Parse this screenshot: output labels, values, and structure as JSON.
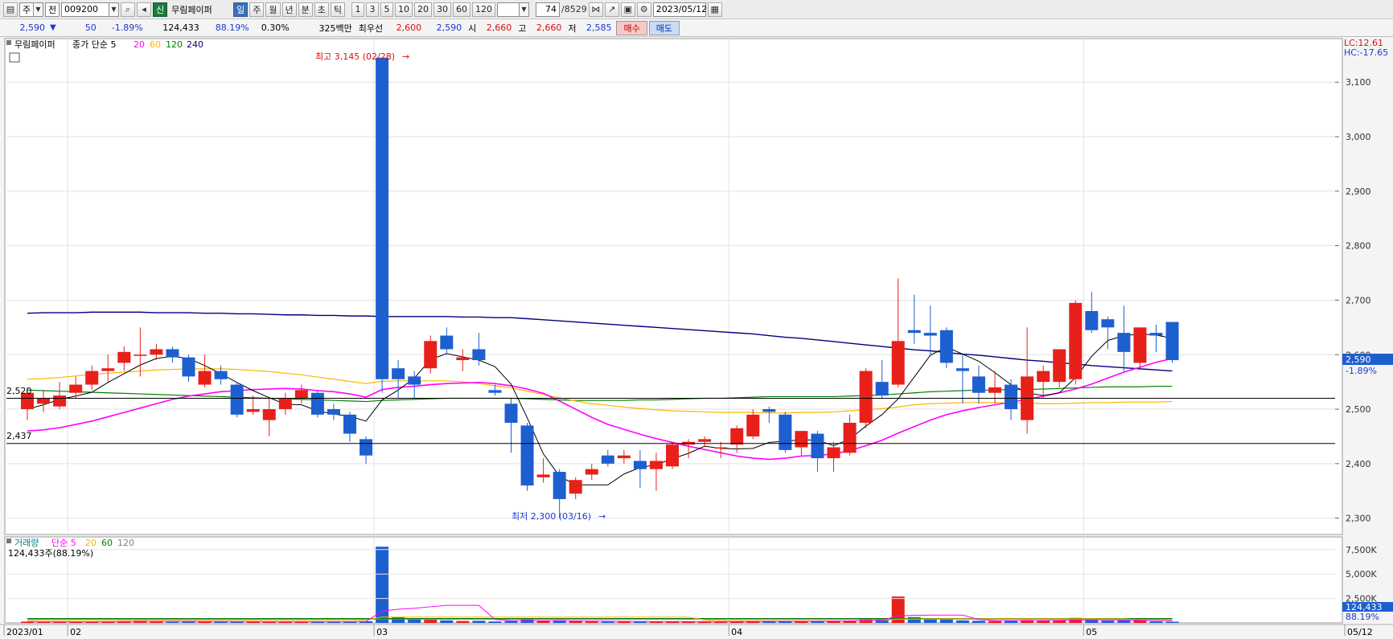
{
  "toolbar": {
    "market_type": "주",
    "market_sub": "전",
    "stock_code": "009200",
    "credit_badge": "신",
    "stock_name": "무림페이퍼",
    "periods": [
      "일",
      "주",
      "월",
      "년",
      "분",
      "초",
      "틱"
    ],
    "active_period": "일",
    "intervals": [
      "1",
      "3",
      "5",
      "10",
      "20",
      "30",
      "60",
      "120"
    ],
    "count_value": "74",
    "count_total": "/8529",
    "date": "2023/05/12"
  },
  "infobar": {
    "price": "2,590",
    "change_arrow": "▼",
    "change": "50",
    "change_pct": "-1.89%",
    "volume": "124,433",
    "volume_ratio": "88.19%",
    "turnover": "0.30%",
    "amount": "325백만",
    "best_label": "최우선",
    "best_ask": "2,600",
    "best_bid": "2,590",
    "open_label": "시",
    "open": "2,660",
    "high_label": "고",
    "high": "2,660",
    "low_label": "저",
    "low": "2,585",
    "buy_button": "매수",
    "sell_button": "매도"
  },
  "price_panel": {
    "stock_tag": "무림페이퍼",
    "ma_title": "종가 단순 5",
    "ma_periods": [
      {
        "label": "20",
        "color": "#ff00ff"
      },
      {
        "label": "60",
        "color": "#ffb400"
      },
      {
        "label": "120",
        "color": "#008000"
      },
      {
        "label": "240",
        "color": "#000080"
      }
    ],
    "lc_label": "LC:12.61",
    "hc_label": "HC:-17.65",
    "high_note": "최고 3,145 (02/28)",
    "low_note": "최저 2,300 (03/16)",
    "hline_1": "2,520",
    "hline_2": "2,437",
    "current_tag": "2,590",
    "current_pct": "-1.89%",
    "y_ticks": [
      "3,100",
      "3,000",
      "2,900",
      "2,800",
      "2,700",
      "2,600",
      "2,500",
      "2,400",
      "2,300"
    ]
  },
  "volume_panel": {
    "title": "거래량",
    "ma_title": "단순 5",
    "ma_periods": [
      {
        "label": "20",
        "color": "#ffb400"
      },
      {
        "label": "60",
        "color": "#008000"
      },
      {
        "label": "120",
        "color": "#808080"
      }
    ],
    "summary": "124,433주(88.19%)",
    "y_ticks": [
      "7,500K",
      "5,000K",
      "2,500K"
    ],
    "current_tag": "124,433",
    "current_pct": "88.19%"
  },
  "x_labels": [
    "2023/01",
    "02",
    "03",
    "04",
    "05",
    "05/12"
  ],
  "colors": {
    "up": "#e8201a",
    "down": "#1e5fd0"
  },
  "chart_data": {
    "type": "candlestick",
    "ylim": [
      2270,
      3180
    ],
    "volume_ylim": [
      0,
      8800000
    ],
    "candles": [
      {
        "o": 2500,
        "c": 2530,
        "h": 2540,
        "l": 2480,
        "v": 130000
      },
      {
        "o": 2510,
        "c": 2520,
        "h": 2535,
        "l": 2495,
        "v": 90000
      },
      {
        "o": 2505,
        "c": 2525,
        "h": 2550,
        "l": 2500,
        "v": 100000
      },
      {
        "o": 2530,
        "c": 2545,
        "h": 2560,
        "l": 2520,
        "v": 110000
      },
      {
        "o": 2545,
        "c": 2570,
        "h": 2580,
        "l": 2535,
        "v": 120000
      },
      {
        "o": 2570,
        "c": 2575,
        "h": 2600,
        "l": 2550,
        "v": 140000
      },
      {
        "o": 2585,
        "c": 2605,
        "h": 2615,
        "l": 2570,
        "v": 180000
      },
      {
        "o": 2600,
        "c": 2600,
        "h": 2650,
        "l": 2560,
        "v": 220000
      },
      {
        "o": 2600,
        "c": 2610,
        "h": 2620,
        "l": 2590,
        "v": 130000
      },
      {
        "o": 2610,
        "c": 2595,
        "h": 2615,
        "l": 2585,
        "v": 110000
      },
      {
        "o": 2595,
        "c": 2560,
        "h": 2600,
        "l": 2550,
        "v": 150000
      },
      {
        "o": 2545,
        "c": 2570,
        "h": 2600,
        "l": 2540,
        "v": 140000
      },
      {
        "o": 2570,
        "c": 2555,
        "h": 2580,
        "l": 2545,
        "v": 120000
      },
      {
        "o": 2545,
        "c": 2490,
        "h": 2550,
        "l": 2485,
        "v": 170000
      },
      {
        "o": 2495,
        "c": 2500,
        "h": 2525,
        "l": 2490,
        "v": 130000
      },
      {
        "o": 2480,
        "c": 2500,
        "h": 2520,
        "l": 2450,
        "v": 150000
      },
      {
        "o": 2500,
        "c": 2520,
        "h": 2530,
        "l": 2490,
        "v": 120000
      },
      {
        "o": 2520,
        "c": 2535,
        "h": 2545,
        "l": 2510,
        "v": 130000
      },
      {
        "o": 2530,
        "c": 2490,
        "h": 2535,
        "l": 2485,
        "v": 140000
      },
      {
        "o": 2500,
        "c": 2490,
        "h": 2510,
        "l": 2480,
        "v": 110000
      },
      {
        "o": 2490,
        "c": 2455,
        "h": 2495,
        "l": 2440,
        "v": 160000
      },
      {
        "o": 2445,
        "c": 2415,
        "h": 2450,
        "l": 2400,
        "v": 180000
      },
      {
        "o": 3145,
        "c": 2555,
        "h": 3145,
        "l": 2530,
        "v": 7800000
      },
      {
        "o": 2575,
        "c": 2555,
        "h": 2590,
        "l": 2520,
        "v": 620000
      },
      {
        "o": 2560,
        "c": 2545,
        "h": 2570,
        "l": 2520,
        "v": 350000
      },
      {
        "o": 2575,
        "c": 2625,
        "h": 2635,
        "l": 2565,
        "v": 320000
      },
      {
        "o": 2635,
        "c": 2610,
        "h": 2650,
        "l": 2600,
        "v": 260000
      },
      {
        "o": 2590,
        "c": 2595,
        "h": 2610,
        "l": 2570,
        "v": 200000
      },
      {
        "o": 2610,
        "c": 2590,
        "h": 2640,
        "l": 2580,
        "v": 220000
      },
      {
        "o": 2535,
        "c": 2530,
        "h": 2545,
        "l": 2525,
        "v": 150000
      },
      {
        "o": 2510,
        "c": 2475,
        "h": 2520,
        "l": 2420,
        "v": 200000
      },
      {
        "o": 2470,
        "c": 2360,
        "h": 2475,
        "l": 2350,
        "v": 350000
      },
      {
        "o": 2375,
        "c": 2380,
        "h": 2410,
        "l": 2365,
        "v": 220000
      },
      {
        "o": 2385,
        "c": 2335,
        "h": 2390,
        "l": 2300,
        "v": 280000
      },
      {
        "o": 2345,
        "c": 2370,
        "h": 2375,
        "l": 2335,
        "v": 180000
      },
      {
        "o": 2380,
        "c": 2390,
        "h": 2400,
        "l": 2370,
        "v": 150000
      },
      {
        "o": 2415,
        "c": 2400,
        "h": 2425,
        "l": 2395,
        "v": 130000
      },
      {
        "o": 2410,
        "c": 2415,
        "h": 2425,
        "l": 2400,
        "v": 120000
      },
      {
        "o": 2405,
        "c": 2390,
        "h": 2425,
        "l": 2355,
        "v": 160000
      },
      {
        "o": 2390,
        "c": 2405,
        "h": 2420,
        "l": 2350,
        "v": 150000
      },
      {
        "o": 2395,
        "c": 2435,
        "h": 2440,
        "l": 2390,
        "v": 170000
      },
      {
        "o": 2435,
        "c": 2440,
        "h": 2445,
        "l": 2410,
        "v": 130000
      },
      {
        "o": 2440,
        "c": 2445,
        "h": 2450,
        "l": 2430,
        "v": 120000
      },
      {
        "o": 2430,
        "c": 2430,
        "h": 2440,
        "l": 2410,
        "v": 110000
      },
      {
        "o": 2435,
        "c": 2465,
        "h": 2470,
        "l": 2420,
        "v": 150000
      },
      {
        "o": 2450,
        "c": 2490,
        "h": 2500,
        "l": 2445,
        "v": 170000
      },
      {
        "o": 2500,
        "c": 2495,
        "h": 2505,
        "l": 2475,
        "v": 130000
      },
      {
        "o": 2490,
        "c": 2425,
        "h": 2495,
        "l": 2420,
        "v": 200000
      },
      {
        "o": 2430,
        "c": 2460,
        "h": 2460,
        "l": 2415,
        "v": 160000
      },
      {
        "o": 2455,
        "c": 2410,
        "h": 2460,
        "l": 2385,
        "v": 190000
      },
      {
        "o": 2410,
        "c": 2430,
        "h": 2440,
        "l": 2385,
        "v": 170000
      },
      {
        "o": 2420,
        "c": 2475,
        "h": 2490,
        "l": 2415,
        "v": 230000
      },
      {
        "o": 2475,
        "c": 2570,
        "h": 2575,
        "l": 2465,
        "v": 420000
      },
      {
        "o": 2550,
        "c": 2525,
        "h": 2590,
        "l": 2520,
        "v": 350000
      },
      {
        "o": 2545,
        "c": 2625,
        "h": 2740,
        "l": 2540,
        "v": 2700000
      },
      {
        "o": 2645,
        "c": 2640,
        "h": 2710,
        "l": 2620,
        "v": 600000
      },
      {
        "o": 2640,
        "c": 2635,
        "h": 2690,
        "l": 2600,
        "v": 400000
      },
      {
        "o": 2645,
        "c": 2585,
        "h": 2650,
        "l": 2575,
        "v": 350000
      },
      {
        "o": 2575,
        "c": 2570,
        "h": 2600,
        "l": 2510,
        "v": 260000
      },
      {
        "o": 2560,
        "c": 2530,
        "h": 2580,
        "l": 2510,
        "v": 220000
      },
      {
        "o": 2530,
        "c": 2540,
        "h": 2570,
        "l": 2510,
        "v": 200000
      },
      {
        "o": 2545,
        "c": 2500,
        "h": 2555,
        "l": 2480,
        "v": 240000
      },
      {
        "o": 2480,
        "c": 2560,
        "h": 2650,
        "l": 2455,
        "v": 300000
      },
      {
        "o": 2550,
        "c": 2570,
        "h": 2580,
        "l": 2520,
        "v": 230000
      },
      {
        "o": 2550,
        "c": 2610,
        "h": 2610,
        "l": 2540,
        "v": 260000
      },
      {
        "o": 2555,
        "c": 2695,
        "h": 2700,
        "l": 2545,
        "v": 520000
      },
      {
        "o": 2680,
        "c": 2645,
        "h": 2715,
        "l": 2640,
        "v": 350000
      },
      {
        "o": 2665,
        "c": 2650,
        "h": 2670,
        "l": 2610,
        "v": 240000
      },
      {
        "o": 2640,
        "c": 2605,
        "h": 2690,
        "l": 2570,
        "v": 260000
      },
      {
        "o": 2585,
        "c": 2650,
        "h": 2650,
        "l": 2575,
        "v": 250000
      },
      {
        "o": 2640,
        "c": 2635,
        "h": 2655,
        "l": 2605,
        "v": 160000
      },
      {
        "o": 2660,
        "c": 2590,
        "h": 2660,
        "l": 2585,
        "v": 124433
      }
    ],
    "ma5_line": [
      2500,
      2508,
      2518,
      2524,
      2531,
      2549,
      2565,
      2581,
      2593,
      2597,
      2593,
      2580,
      2565,
      2549,
      2534,
      2521,
      2509,
      2508,
      2497,
      2491,
      2487,
      2478,
      2517,
      2535,
      2557,
      2591,
      2602,
      2596,
      2590,
      2578,
      2546,
      2484,
      2418,
      2377,
      2361,
      2361,
      2361,
      2381,
      2393,
      2398,
      2409,
      2419,
      2432,
      2428,
      2427,
      2428,
      2439,
      2441,
      2444,
      2443,
      2433,
      2445,
      2469,
      2490,
      2519,
      2559,
      2599,
      2614,
      2601,
      2588,
      2567,
      2545,
      2530,
      2525,
      2530,
      2558,
      2597,
      2626,
      2635,
      2638,
      2636,
      2630
    ],
    "ma20_line": [
      2460,
      2462,
      2466,
      2472,
      2478,
      2486,
      2494,
      2502,
      2510,
      2518,
      2524,
      2528,
      2532,
      2534,
      2536,
      2537,
      2538,
      2537,
      2534,
      2532,
      2528,
      2522,
      2536,
      2540,
      2542,
      2545,
      2547,
      2548,
      2549,
      2547,
      2543,
      2537,
      2529,
      2515,
      2500,
      2485,
      2472,
      2463,
      2454,
      2446,
      2439,
      2432,
      2426,
      2420,
      2414,
      2410,
      2408,
      2410,
      2414,
      2415,
      2418,
      2424,
      2433,
      2443,
      2456,
      2468,
      2480,
      2490,
      2497,
      2503,
      2508,
      2513,
      2518,
      2524,
      2530,
      2537,
      2546,
      2557,
      2568,
      2577,
      2586,
      2593
    ],
    "ma60_line": [
      2555,
      2556,
      2558,
      2561,
      2564,
      2566,
      2568,
      2570,
      2572,
      2573,
      2574,
      2574,
      2574,
      2573,
      2571,
      2569,
      2566,
      2563,
      2559,
      2555,
      2551,
      2547,
      2551,
      2552,
      2552,
      2552,
      2552,
      2550,
      2547,
      2543,
      2539,
      2533,
      2527,
      2521,
      2515,
      2510,
      2507,
      2504,
      2501,
      2499,
      2497,
      2496,
      2495,
      2494,
      2494,
      2494,
      2493,
      2493,
      2494,
      2494,
      2495,
      2497,
      2499,
      2501,
      2504,
      2508,
      2510,
      2511,
      2512,
      2512,
      2512,
      2511,
      2511,
      2510,
      2510,
      2511,
      2512,
      2512,
      2513,
      2513,
      2513,
      2514
    ],
    "ma120_line": [
      2535,
      2534,
      2533,
      2532,
      2531,
      2530,
      2529,
      2528,
      2527,
      2526,
      2525,
      2524,
      2523,
      2522,
      2521,
      2520,
      2519,
      2518,
      2517,
      2516,
      2515,
      2514,
      2516,
      2517,
      2518,
      2519,
      2520,
      2520,
      2520,
      2520,
      2520,
      2519,
      2518,
      2517,
      2516,
      2516,
      2516,
      2516,
      2517,
      2517,
      2518,
      2519,
      2520,
      2520,
      2521,
      2522,
      2523,
      2523,
      2523,
      2523,
      2523,
      2524,
      2525,
      2526,
      2528,
      2530,
      2532,
      2533,
      2534,
      2535,
      2535,
      2536,
      2536,
      2537,
      2538,
      2539,
      2540,
      2541,
      2541,
      2541,
      2542,
      2542
    ],
    "ma240_line": [
      2676,
      2677,
      2677,
      2677,
      2678,
      2678,
      2678,
      2678,
      2677,
      2677,
      2677,
      2676,
      2676,
      2675,
      2675,
      2674,
      2673,
      2673,
      2672,
      2672,
      2671,
      2671,
      2670,
      2670,
      2670,
      2670,
      2670,
      2669,
      2669,
      2668,
      2668,
      2666,
      2664,
      2662,
      2660,
      2658,
      2656,
      2654,
      2652,
      2650,
      2648,
      2646,
      2644,
      2642,
      2640,
      2638,
      2635,
      2632,
      2630,
      2627,
      2624,
      2621,
      2618,
      2615,
      2612,
      2609,
      2607,
      2604,
      2601,
      2599,
      2596,
      2593,
      2590,
      2588,
      2585,
      2583,
      2580,
      2578,
      2576,
      2574,
      2572,
      2570
    ],
    "vol_ma5": [
      140000,
      135000,
      130000,
      128000,
      126000,
      130000,
      140000,
      150000,
      160000,
      165000,
      160000,
      155000,
      150000,
      145000,
      140000,
      138000,
      136000,
      135000,
      134000,
      133000,
      132000,
      150000,
      1200000,
      1400000,
      1500000,
      1650000,
      1800000,
      1800000,
      1800000,
      350000,
      240000,
      230000,
      230000,
      230000,
      220000,
      200000,
      180000,
      160000,
      150000,
      140000,
      140000,
      140000,
      140000,
      140000,
      140000,
      150000,
      160000,
      160000,
      160000,
      170000,
      180000,
      200000,
      230000,
      270000,
      720000,
      780000,
      800000,
      800000,
      800000,
      350000,
      250000,
      240000,
      240000,
      250000,
      270000,
      300000,
      310000,
      320000,
      300000,
      280000,
      250000,
      210000
    ],
    "vol_ma20": [
      300000,
      300000,
      300000,
      300000,
      300000,
      300000,
      300000,
      300000,
      300000,
      300000,
      300000,
      300000,
      300000,
      300000,
      300000,
      300000,
      300000,
      300000,
      300000,
      300000,
      300000,
      300000,
      600000,
      600000,
      600000,
      600000,
      600000,
      600000,
      600000,
      600000,
      600000,
      600000,
      600000,
      600000,
      600000,
      600000,
      600000,
      600000,
      600000,
      600000,
      600000,
      600000,
      300000,
      250000,
      230000,
      220000,
      220000,
      220000,
      220000,
      220000,
      220000,
      230000,
      250000,
      270000,
      380000,
      400000,
      410000,
      420000,
      420000,
      420000,
      420000,
      420000,
      420000,
      420000,
      420000,
      420000,
      420000,
      420000,
      420000,
      280000,
      270000,
      260000
    ],
    "vol_ma60": [
      450000,
      450000,
      450000,
      450000,
      450000,
      450000,
      450000,
      450000,
      450000,
      450000,
      450000,
      450000,
      450000,
      450000,
      450000,
      450000,
      450000,
      450000,
      450000,
      450000,
      450000,
      450000,
      450000,
      450000,
      450000,
      450000,
      450000,
      450000,
      450000,
      450000,
      450000,
      450000,
      450000,
      450000,
      450000,
      450000,
      450000,
      450000,
      450000,
      450000,
      450000,
      450000,
      450000,
      450000,
      450000,
      450000,
      450000,
      450000,
      450000,
      450000,
      450000,
      450000,
      450000,
      450000,
      450000,
      450000,
      450000,
      450000,
      450000,
      450000,
      450000,
      450000,
      450000,
      450000,
      450000,
      450000,
      450000,
      450000,
      450000,
      450000,
      450000,
      450000
    ],
    "vol_ma120": [
      380000,
      380000,
      380000,
      380000,
      380000,
      380000,
      380000,
      380000,
      380000,
      380000,
      380000,
      380000,
      380000,
      380000,
      380000,
      380000,
      380000,
      380000,
      380000,
      380000,
      380000,
      380000,
      380000,
      380000,
      380000,
      380000,
      380000,
      380000,
      380000,
      380000,
      380000,
      380000,
      380000,
      380000,
      380000,
      380000,
      380000,
      380000,
      380000,
      380000,
      380000,
      380000,
      380000,
      380000,
      380000,
      380000,
      380000,
      380000,
      380000,
      380000,
      380000,
      380000,
      380000,
      380000,
      380000,
      380000,
      380000,
      380000,
      380000,
      380000,
      380000,
      380000,
      380000,
      380000,
      380000,
      380000,
      380000,
      380000,
      380000,
      380000,
      380000,
      380000
    ]
  }
}
